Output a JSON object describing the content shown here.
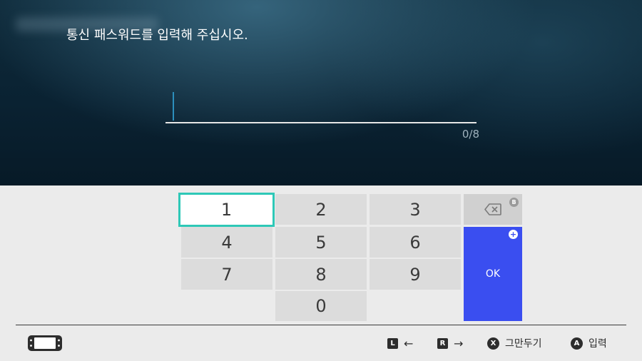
{
  "prompt": "통신 패스워드를 입력해 주십시오.",
  "input": {
    "value": "",
    "counter": "0/8"
  },
  "keys": [
    "1",
    "2",
    "3",
    "4",
    "5",
    "6",
    "7",
    "8",
    "9",
    "0"
  ],
  "selected_key": "1",
  "backspace": {
    "badge": "B",
    "icon": "backspace-icon"
  },
  "ok": {
    "label": "OK",
    "badge": "+"
  },
  "footer": {
    "console_icon": "handheld-console-icon",
    "hints": [
      {
        "button": "L",
        "action": "←"
      },
      {
        "button": "R",
        "action": "→"
      },
      {
        "button": "X",
        "action": "그만두기"
      },
      {
        "button": "A",
        "action": "입력"
      }
    ]
  },
  "colors": {
    "background_top": "#0f2b3b",
    "keyboard_bg": "#ebebeb",
    "key_bg": "#dcdcdc",
    "selection": "#2ec8b7",
    "ok_key": "#3a4ef0",
    "caret": "#2c8fbd"
  }
}
